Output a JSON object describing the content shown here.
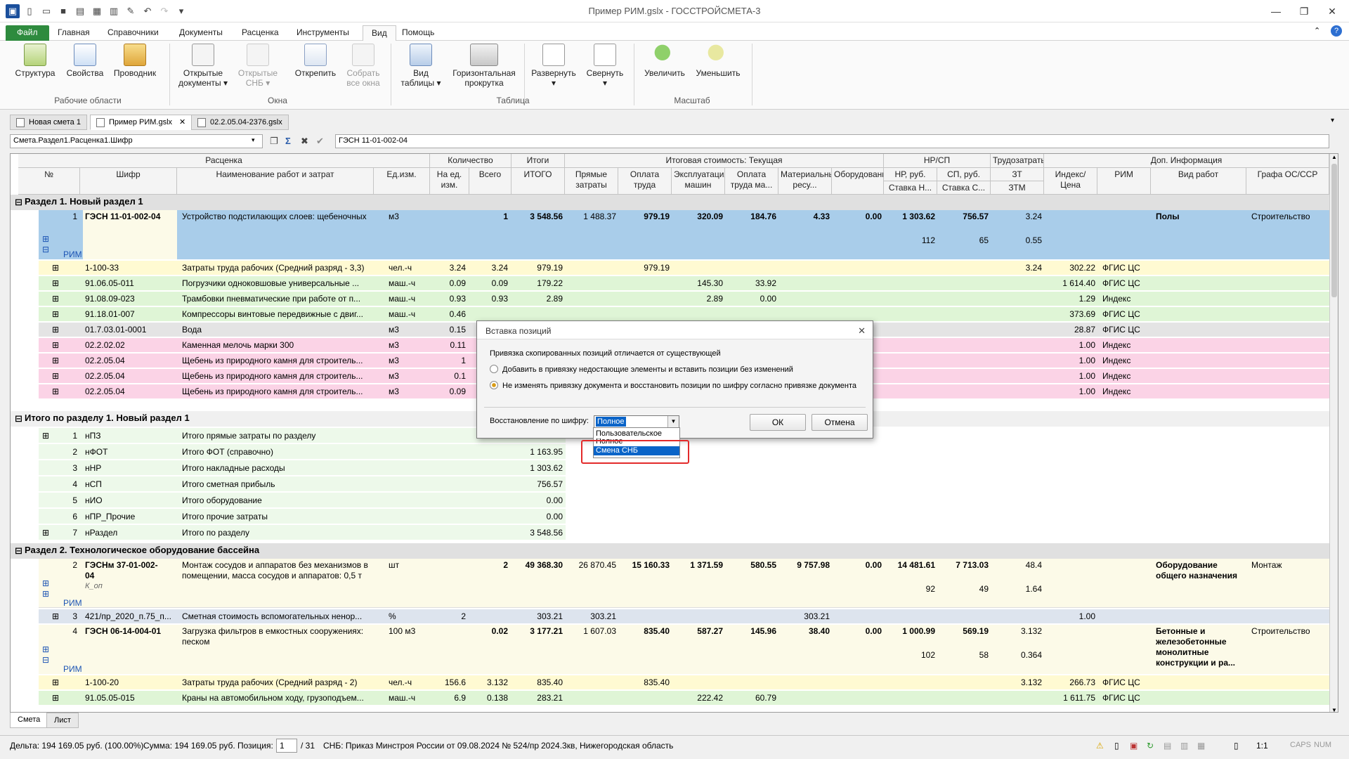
{
  "window": {
    "title": "Пример РИМ.gslx - ГОССТРОЙСМЕТА-3"
  },
  "menu": {
    "file": "Файл",
    "tabs": [
      "Главная",
      "Справочники",
      "Документы",
      "Расценка",
      "Инструменты",
      "Вид",
      "Помощь"
    ],
    "active": "Вид"
  },
  "ribbon": {
    "buttons": [
      "Структура",
      "Свойства",
      "Проводник",
      "Открытые документы",
      "Открытые СНБ",
      "Открепить",
      "Собрать все окна",
      "Вид таблицы",
      "Горизонтальная прокрутка",
      "Развернуть",
      "Свернуть",
      "Увеличить",
      "Уменьшить"
    ],
    "groups": [
      "Рабочие области",
      "Окна",
      "Таблица",
      "Масштаб"
    ]
  },
  "doctabs": [
    "Новая смета 1",
    "Пример РИМ.gslx",
    "02.2.05.04-2376.gslx"
  ],
  "formula": {
    "path": "Смета.Раздел1.Расценка1.Шифр",
    "value": "ГЭСН 11-01-002-04"
  },
  "headers": {
    "top": [
      "Расценка",
      "Количество",
      "Итоги",
      "Итоговая стоимость: Текущая",
      "НР/СП",
      "Трудозатраты",
      "Доп. Информация"
    ],
    "cols": [
      "№",
      "Шифр",
      "Наименование работ и затрат",
      "Ед.изм.",
      "На ед. изм.",
      "Всего",
      "ИТОГО",
      "Прямые затраты",
      "Оплата труда",
      "Эксплуатация машин",
      "Оплата труда ма...",
      "Материальные ресу...",
      "Оборудование",
      "НР, руб.",
      "СП, руб.",
      "ЗТ",
      "Индекс/Цена",
      "РИМ",
      "Вид работ",
      "Графа ОС/ССР"
    ],
    "sub": [
      "Ставка Н...",
      "Ставка С...",
      "ЗТМ"
    ]
  },
  "sections": {
    "s1": "Раздел 1. Новый раздел 1",
    "s1total": "Итого по разделу 1. Новый раздел 1",
    "s2": "Раздел 2. Технологическое оборудование бассейна"
  },
  "rim_label": "РИМ",
  "row1": {
    "n": "1",
    "code": "ГЭСН 11-01-002-04",
    "name": "Устройство подстилающих слоев: щебеночных",
    "unit": "м3",
    "total": "1",
    "itogo": "3 548.56",
    "pz": "1 488.37",
    "ot": "979.19",
    "em": "320.09",
    "otm": "184.76",
    "mr": "4.33",
    "ob": "0.00",
    "nr": "1 303.62",
    "sp": "756.57",
    "zt": "3.24",
    "nr2": "112",
    "sp2": "65",
    "zt2": "0.55",
    "vid": "Полы",
    "os": "Строительство"
  },
  "res1": [
    {
      "code": "1-100-33",
      "name": "Затраты труда рабочих (Средний разряд - 3,3)",
      "unit": "чел.-ч",
      "ned": "3.24",
      "all": "3.24",
      "itogo": "979.19",
      "ot": "979.19",
      "zt": "3.24",
      "idx": "302.22",
      "rim": "ФГИС ЦС"
    },
    {
      "code": "91.06.05-011",
      "name": "Погрузчики одноковшовые универсальные ...",
      "unit": "маш.-ч",
      "ned": "0.09",
      "all": "0.09",
      "itogo": "179.22",
      "em": "145.30",
      "otm": "33.92",
      "idx": "1 614.40",
      "rim": "ФГИС ЦС"
    },
    {
      "code": "91.08.09-023",
      "name": "Трамбовки пневматические при работе от п...",
      "unit": "маш.-ч",
      "ned": "0.93",
      "all": "0.93",
      "itogo": "2.89",
      "em": "2.89",
      "otm": "0.00",
      "idx": "1.29",
      "rim": "Индекс"
    },
    {
      "code": "91.18.01-007",
      "name": "Компрессоры винтовые передвижные с двиг...",
      "unit": "маш.-ч",
      "ned": "0.46",
      "idx": "373.69",
      "rim": "ФГИС ЦС"
    },
    {
      "code": "01.7.03.01-0001",
      "name": "Вода",
      "unit": "м3",
      "ned": "0.15",
      "idx": "28.87",
      "rim": "ФГИС ЦС"
    },
    {
      "code": "02.2.02.02",
      "name": "Каменная мелочь марки 300",
      "unit": "м3",
      "ned": "0.11",
      "idx": "1.00",
      "rim": "Индекс"
    },
    {
      "code": "02.2.05.04",
      "name": "Щебень из природного камня для строитель...",
      "unit": "м3",
      "ned": "1",
      "idx": "1.00",
      "rim": "Индекс"
    },
    {
      "code": "02.2.05.04",
      "name": "Щебень из природного камня для строитель...",
      "unit": "м3",
      "ned": "0.1",
      "idx": "1.00",
      "rim": "Индекс"
    },
    {
      "code": "02.2.05.04",
      "name": "Щебень из природного камня для строитель...",
      "unit": "м3",
      "ned": "0.09",
      "idx": "1.00",
      "rim": "Индекс"
    }
  ],
  "totals": [
    {
      "n": "1",
      "code": "нПЗ",
      "name": "Итого прямые затраты по разделу",
      "val": ""
    },
    {
      "n": "2",
      "code": "нФОТ",
      "name": "Итого ФОТ (справочно)",
      "val": "1 163.95"
    },
    {
      "n": "3",
      "code": "нНР",
      "name": "Итого накладные расходы",
      "val": "1 303.62"
    },
    {
      "n": "4",
      "code": "нСП",
      "name": "Итого сметная прибыль",
      "val": "756.57"
    },
    {
      "n": "5",
      "code": "нИО",
      "name": "Итого оборудование",
      "val": "0.00"
    },
    {
      "n": "6",
      "code": "нПР_Прочие",
      "name": "Итого прочие затраты",
      "val": "0.00"
    },
    {
      "n": "7",
      "code": "нРаздел",
      "name": "Итого по разделу",
      "val": "3 548.56"
    }
  ],
  "row2": {
    "n": "2",
    "code": "ГЭСНм 37-01-002-04",
    "sub": "К_оп",
    "name": "Монтаж сосудов и аппаратов без механизмов в помещении, масса сосудов и аппаратов: 0,5 т",
    "unit": "шт",
    "total": "2",
    "itogo": "49 368.30",
    "pz": "26 870.45",
    "ot": "15 160.33",
    "em": "1 371.59",
    "otm": "580.55",
    "mr": "9 757.98",
    "ob": "0.00",
    "nr": "14 481.61",
    "sp": "7 713.03",
    "zt": "48.4",
    "nr2": "92",
    "sp2": "49",
    "zt2": "1.64",
    "vid": "Оборудование общего назначения",
    "os": "Монтаж"
  },
  "row3": {
    "n": "3",
    "code": "421/пр_2020_п.75_п...",
    "name": "Сметная стоимость вспомогательных ненор...",
    "unit": "%",
    "ned": "2",
    "itogo": "303.21",
    "pz": "303.21",
    "mr": "303.21",
    "idx": "1.00"
  },
  "row4": {
    "n": "4",
    "code": "ГЭСН 06-14-004-01",
    "name": "Загрузка фильтров в емкостных сооружениях: песком",
    "unit": "100 м3",
    "total": "0.02",
    "itogo": "3 177.21",
    "pz": "1 607.03",
    "ot": "835.40",
    "em": "587.27",
    "otm": "145.96",
    "mr": "38.40",
    "ob": "0.00",
    "nr": "1 000.99",
    "sp": "569.19",
    "zt": "3.132",
    "nr2": "102",
    "sp2": "58",
    "zt2": "0.364",
    "vid": "Бетонные и железобетонные монолитные конструкции и ра...",
    "os": "Строительство"
  },
  "res4": [
    {
      "code": "1-100-20",
      "name": "Затраты труда рабочих (Средний разряд - 2)",
      "unit": "чел.-ч",
      "ned": "156.6",
      "all": "3.132",
      "itogo": "835.40",
      "ot": "835.40",
      "zt": "3.132",
      "idx": "266.73",
      "rim": "ФГИС ЦС"
    },
    {
      "code": "91.05.05-015",
      "name": "Краны на автомобильном ходу, грузоподъем...",
      "unit": "маш.-ч",
      "ned": "6.9",
      "all": "0.138",
      "itogo": "283.21",
      "em": "222.42",
      "otm": "60.79",
      "idx": "1 611.75",
      "rim": "ФГИС ЦС"
    }
  ],
  "dialog": {
    "title": "Вставка позиций",
    "message": "Привязка скопированных позиций отличается от существующей",
    "opt1": "Добавить в привязку недостающие элементы и вставить позиции без изменений",
    "opt2": "Не изменять привязку документа и восстановить позиции по шифру согласно привязке документа",
    "restore_label": "Восстановление по шифру:",
    "restore_value": "Полное",
    "ok": "ОК",
    "cancel": "Отмена",
    "options": [
      "Пользовательское",
      "Полное",
      "Смена СНБ"
    ]
  },
  "bottomtabs": [
    "Смета",
    "Лист"
  ],
  "status": {
    "delta": "Дельта: 194 169.05 руб. (100.00%)",
    "sum": "Сумма: 194 169.05 руб.",
    "pos_label": "Позиция:",
    "pos": "1",
    "of": "/ 31",
    "snb": "СНБ: Приказ Минстроя России от 09.08.2024 № 524/пр",
    "region": "2024.3кв, Нижегородская область",
    "zoom": "1:1",
    "caps": "CAPS",
    "num": "NUM"
  }
}
